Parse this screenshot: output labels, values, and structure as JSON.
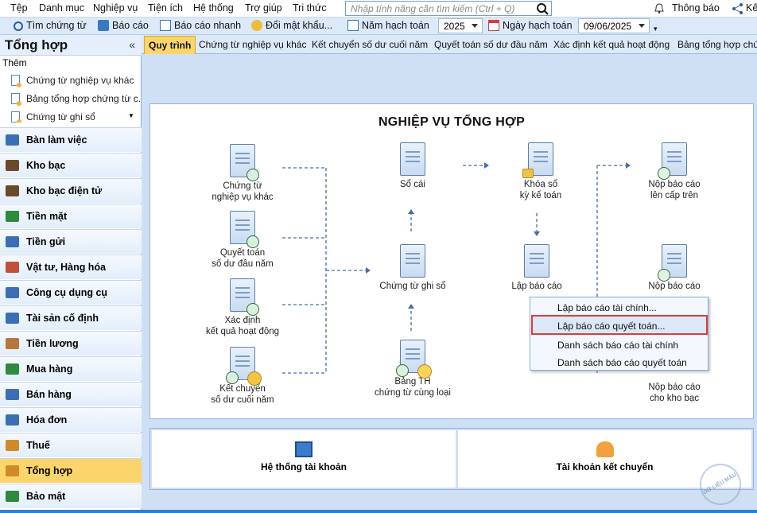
{
  "menu": [
    "Tệp",
    "Danh mục",
    "Nghiệp vụ",
    "Tiện ích",
    "Hệ thống",
    "Trợ giúp",
    "Tri thức"
  ],
  "search": {
    "placeholder": "Nhập tính năng cần tìm kiếm (Ctrl + Q)"
  },
  "notify": "Thông báo",
  "toolbar": {
    "find_voucher": "Tìm chứng từ",
    "report": "Báo cáo",
    "quick_report": "Báo cáo nhanh",
    "change_password": "Đổi mật khẩu...",
    "year_label": "Năm hạch toán",
    "year_value": "2025",
    "date_label": "Ngày hạch toán",
    "date_value": "09/06/2025"
  },
  "sidebar": {
    "title": "Tổng hợp",
    "add_label": "Thêm",
    "shortcuts": [
      "Chứng từ nghiệp vụ khác",
      "Bảng tổng hợp chứng từ c...",
      "Chứng từ ghi sổ"
    ],
    "modules": [
      "Bàn làm việc",
      "Kho bạc",
      "Kho bạc điện tử",
      "Tiền mặt",
      "Tiền gửi",
      "Vật tư, Hàng hóa",
      "Công cụ dụng cụ",
      "Tài sản cố định",
      "Tiền lương",
      "Mua hàng",
      "Bán hàng",
      "Hóa đơn",
      "Thuế",
      "Tổng hợp",
      "Bảo mật"
    ],
    "active_module": "Tổng hợp"
  },
  "tabs": [
    "Quy trình",
    "Chứng từ nghiệp vụ khác",
    "Kết chuyển số dư cuối năm",
    "Quyết toán số dư đầu năm",
    "Xác định kết quả hoạt động",
    "Bảng tổng hợp chứng"
  ],
  "flow": {
    "title": "NGHIỆP VỤ TỔNG HỢP",
    "inputs": [
      [
        "Chứng từ",
        "nghiệp vụ khác"
      ],
      [
        "Quyết toán",
        "số dư đầu năm"
      ],
      [
        "Xác định",
        "kết quả hoạt động"
      ],
      [
        "Kết chuyển",
        "số dư cuối năm"
      ]
    ],
    "ledger": "Sổ cái",
    "voucher_book": "Chứng từ ghi sổ",
    "summary": [
      "Bảng TH",
      "chứng từ cùng loại"
    ],
    "lock": [
      "Khóa sổ",
      "kỳ kế toán"
    ],
    "make_report": "Lập báo cáo",
    "submit_up": [
      "Nộp báo cáo",
      "lên cấp trên"
    ],
    "submit_mid": "Nộp báo cáo",
    "submit_treasury": [
      "Nộp báo cáo",
      "cho kho bạc"
    ]
  },
  "context_menu": [
    "Lập báo cáo tài chính...",
    "Lập báo cáo quyết toán...",
    "Danh sách báo cáo tài chính",
    "Danh sách báo cáo quyết toán"
  ],
  "bottom": {
    "accounts": "Hệ thống tài khoản",
    "transfer_accounts": "Tài khoản kết chuyển"
  },
  "watermark": "DỮ LIỆU MẪU"
}
